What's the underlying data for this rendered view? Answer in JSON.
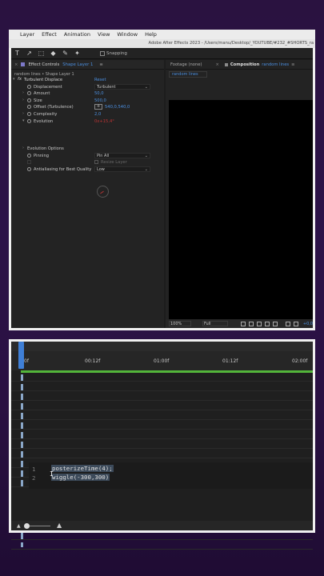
{
  "menubar": {
    "items": [
      "Layer",
      "Effect",
      "Animation",
      "View",
      "Window",
      "Help"
    ]
  },
  "window": {
    "title": "Adobe After Effects 2023 - /Users/manu/Desktop/_YOUTUBE/#232_#SHORTS_ra"
  },
  "toolbar": {
    "tools": [
      "T",
      "↗",
      "⬚",
      "◆",
      "✎",
      "✦"
    ],
    "snapping_label": "Snapping"
  },
  "effect_controls": {
    "tab_label": "Effect Controls",
    "layer_name": "Shape Layer 1",
    "subtitle": "random lines • Shape Layer 1",
    "effect_name": "Turbulent Displace",
    "reset_label": "Reset",
    "props": {
      "displacement": {
        "label": "Displacement",
        "value": "Turbulent"
      },
      "amount": {
        "label": "Amount",
        "value": "50,0"
      },
      "size": {
        "label": "Size",
        "value": "500,0"
      },
      "offset": {
        "label": "Offset (Turbulence)",
        "value": "540,0,540,0"
      },
      "complexity": {
        "label": "Complexity",
        "value": "2,0"
      },
      "evolution": {
        "label": "Evolution",
        "value": "0x+15,4°"
      },
      "evolution_options": {
        "label": "Evolution Options"
      },
      "pinning": {
        "label": "Pinning",
        "value": "Pin All"
      },
      "resize_layer": {
        "label": "Resize Layer"
      },
      "antialiasing": {
        "label": "Antialiasing for Best Quality",
        "value": "Low"
      }
    }
  },
  "composition": {
    "footage_tab": "Footage (none)",
    "comp_tab": "Composition",
    "comp_name": "random lines",
    "viewer_tag": "random lines",
    "zoom": "100%",
    "resolution": "Full",
    "exposure": "+0,0"
  },
  "timeline": {
    "ticks": [
      "0f",
      "00:12f",
      "01:00f",
      "01:12f",
      "02:00f"
    ],
    "expression": {
      "lines": [
        {
          "num": "1",
          "code": "posterizeTime(4);"
        },
        {
          "num": "2",
          "code": "wiggle(-300,300)"
        }
      ]
    }
  }
}
